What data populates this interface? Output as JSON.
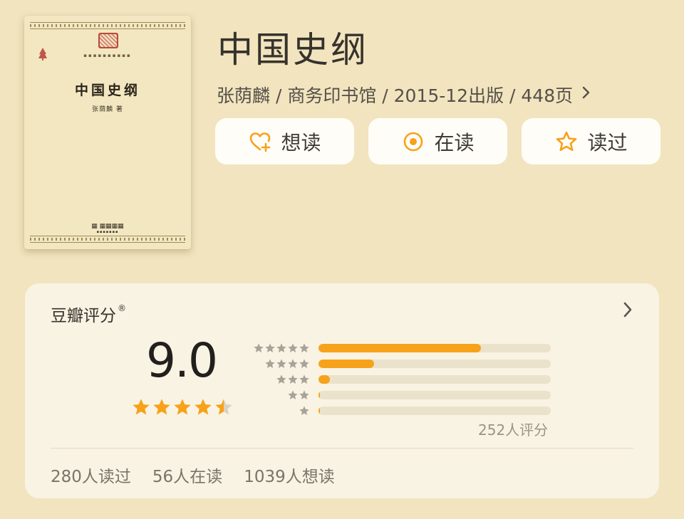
{
  "book": {
    "title": "中国史纲",
    "meta": "张荫麟 / 商务印书馆 / 2015-12出版 / 448页",
    "cover": {
      "title": "中国史纲",
      "author": "张荫麟 著"
    }
  },
  "actions": [
    {
      "label": "想读",
      "icon": "heart-plus-icon"
    },
    {
      "label": "在读",
      "icon": "target-circle-icon"
    },
    {
      "label": "读过",
      "icon": "star-outline-icon"
    }
  ],
  "rating": {
    "title": "豆瓣评分",
    "registered_mark": "®",
    "score": "9.0",
    "stars_value": 4.5,
    "distribution": [
      {
        "stars": 5,
        "fraction": 0.7
      },
      {
        "stars": 4,
        "fraction": 0.24
      },
      {
        "stars": 3,
        "fraction": 0.05
      },
      {
        "stars": 2,
        "fraction": 0.005
      },
      {
        "stars": 1,
        "fraction": 0.005
      }
    ],
    "count_text": "252人评分"
  },
  "stats": {
    "read": "280人读过",
    "reading": "56人在读",
    "want": "1039人想读"
  },
  "colors": {
    "background": "#f1e4bf",
    "accent": "#f7a21b",
    "card": "#f9f3e3"
  }
}
